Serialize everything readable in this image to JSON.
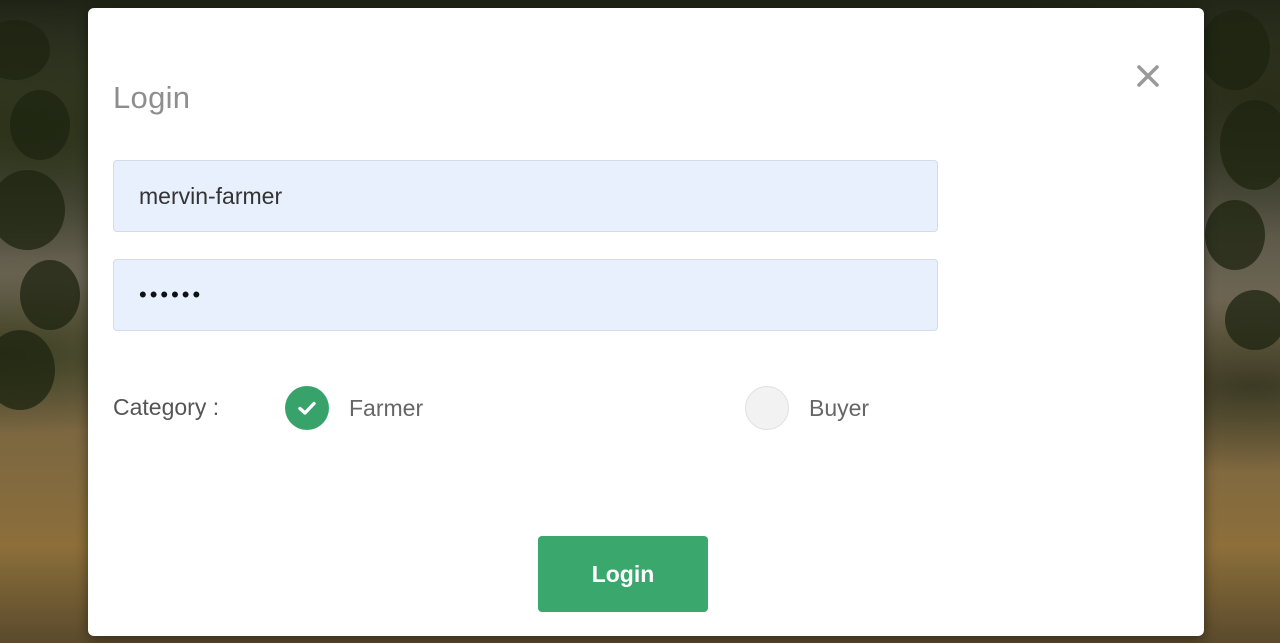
{
  "login_modal": {
    "title": "Login",
    "close_icon": "close-icon",
    "username_value": "mervin-farmer",
    "password_value": "xxxxxx",
    "category_label": "Category :",
    "options": [
      {
        "label": "Farmer",
        "checked": true,
        "icon": "check-icon"
      },
      {
        "label": "Buyer",
        "checked": false
      }
    ],
    "submit_label": "Login",
    "accent_color": "#3aa76d"
  }
}
